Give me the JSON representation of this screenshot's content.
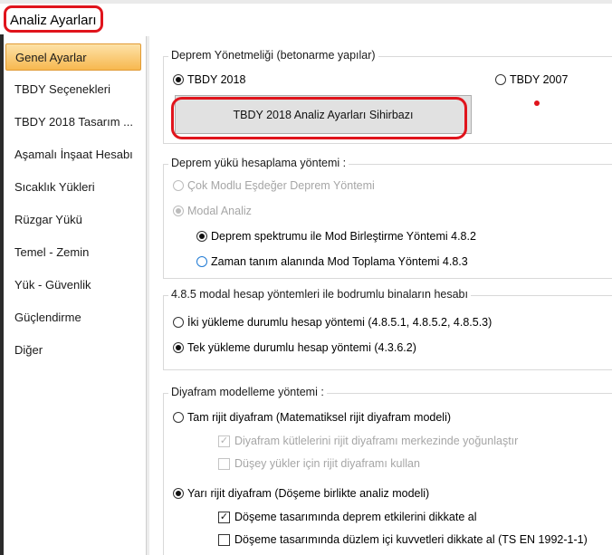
{
  "window": {
    "title": "Analiz Ayarları"
  },
  "sidebar": {
    "items": [
      {
        "label": "Genel Ayarlar",
        "selected": true
      },
      {
        "label": "TBDY Seçenekleri"
      },
      {
        "label": "TBDY 2018 Tasarım ..."
      },
      {
        "label": "Aşamalı İnşaat Hesabı"
      },
      {
        "label": "Sıcaklık Yükleri"
      },
      {
        "label": "Rüzgar Yükü"
      },
      {
        "label": "Temel - Zemin"
      },
      {
        "label": "Yük - Güvenlik"
      },
      {
        "label": "Güçlendirme"
      },
      {
        "label": "Diğer"
      }
    ]
  },
  "regulation": {
    "label": "Deprem Yönetmeliği (betonarme yapılar)",
    "tbdy2018": {
      "label": "TBDY 2018",
      "checked": true
    },
    "tbdy2007": {
      "label": "TBDY 2007",
      "checked": false
    },
    "wizard_button": "TBDY 2018 Analiz Ayarları Sihirbazı"
  },
  "calc_method": {
    "label": "Deprem yükü hesaplama yöntemi :",
    "options": [
      {
        "label": "Çok Modlu Eşdeğer Deprem Yöntemi",
        "checked": false,
        "disabled": true
      },
      {
        "label": "Modal Analiz",
        "checked": true,
        "disabled": true
      },
      {
        "label": "Deprem spektrumu ile Mod Birleştirme Yöntemi 4.8.2",
        "checked": true
      },
      {
        "label": "Zaman tanım alanında Mod Toplama Yöntemi 4.8.3",
        "checked": false
      }
    ]
  },
  "modal_methods": {
    "label": "4.8.5 modal hesap yöntemleri ile bodrumlu binaların hesabı",
    "options": [
      {
        "label": "İki yükleme durumlu hesap yöntemi (4.8.5.1, 4.8.5.2, 4.8.5.3)",
        "checked": false
      },
      {
        "label": "Tek yükleme durumlu hesap yöntemi (4.3.6.2)",
        "checked": true
      }
    ]
  },
  "diaphragm": {
    "label": "Diyafram modelleme yöntemi :",
    "rigid": {
      "label": "Tam rijit diyafram (Matematiksel rijit diyafram modeli)",
      "checked": false
    },
    "rigid_opt1": {
      "label": "Diyafram kütlelerini rijit diyaframı merkezinde yoğunlaştır",
      "checked": true,
      "disabled": true
    },
    "rigid_opt2": {
      "label": "Düşey yükler için rijit diyaframı kullan",
      "checked": false,
      "disabled": true
    },
    "semi": {
      "label": "Yarı rijit diyafram (Döşeme birlikte analiz modeli)",
      "checked": true
    },
    "semi_opt1": {
      "label": "Döşeme tasarımında deprem etkilerini dikkate al",
      "checked": true
    },
    "semi_opt2": {
      "label": "Döşeme tasarımında düzlem içi kuvvetleri dikkate al (TS EN 1992-1-1)",
      "checked": false
    }
  },
  "colors": {
    "highlight_red": "#e0141c",
    "selected_orange": "#f7b84f",
    "radio_blue": "#1f7ad4"
  }
}
